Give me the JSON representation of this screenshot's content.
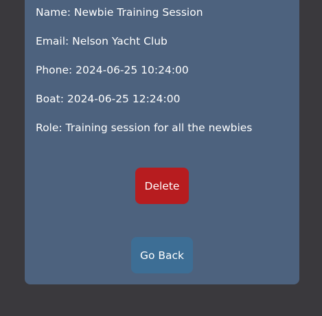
{
  "details": {
    "name": "Name: Newbie Training Session",
    "email": "Email: Nelson Yacht Club",
    "phone": "Phone: 2024-06-25 10:24:00",
    "boat": "Boat: 2024-06-25 12:24:00",
    "role": "Role: Training session for all the newbies"
  },
  "actions": {
    "delete_label": "Delete",
    "back_label": "Go Back"
  },
  "colors": {
    "page_background": "#3a393d",
    "card_background": "#4d627e",
    "delete_button": "#b71c1f",
    "back_button": "#3d6e95",
    "text": "#ffffff"
  }
}
